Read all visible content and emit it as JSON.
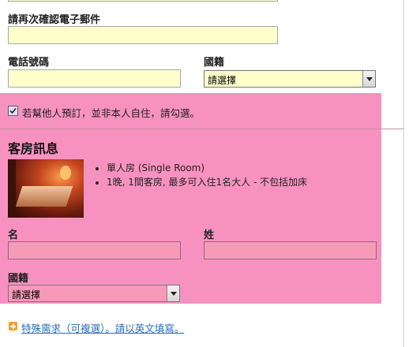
{
  "confirm_email": {
    "label": "請再次確認電子郵件",
    "value": ""
  },
  "phone": {
    "label": "電話號碼",
    "value": ""
  },
  "nationality": {
    "label": "國籍",
    "selected": "請選擇"
  },
  "booking_for_other": {
    "checked": true,
    "label": "若幫他人預訂，並非本人自住，請勾選。"
  },
  "room_info": {
    "title": "客房訊息",
    "details": [
      "單人房 (Single Room)",
      "1晚, 1間客房, 最多可入住1名大人 - 不包括加床"
    ]
  },
  "guest": {
    "first_name_label": "名",
    "last_name_label": "姓",
    "first_name_value": "",
    "last_name_value": "",
    "nationality_label": "國籍",
    "nationality_selected": "請選擇"
  },
  "special_request": {
    "link": "特殊需求（可複選）。請以英文填寫。"
  },
  "colors": {
    "highlight": "#f792c0",
    "field_yellow": "#ffffcc",
    "link": "#2a6bb0",
    "plus_icon": "#f0a020"
  }
}
